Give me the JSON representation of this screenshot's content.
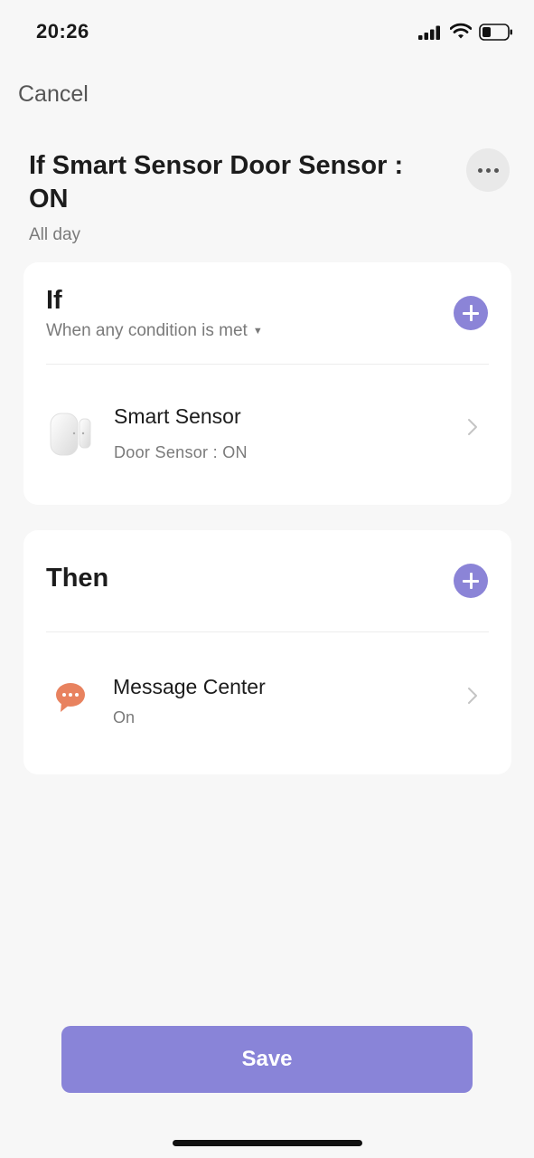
{
  "status_bar": {
    "time": "20:26"
  },
  "nav": {
    "cancel_label": "Cancel"
  },
  "header": {
    "title": "If Smart Sensor Door Sensor : ON",
    "subtitle": "All day"
  },
  "if_section": {
    "title": "If",
    "condition_mode": "When any condition is met",
    "items": [
      {
        "name": "Smart Sensor",
        "detail": "Door Sensor : ON",
        "icon": "door-sensor-icon"
      }
    ]
  },
  "then_section": {
    "title": "Then",
    "items": [
      {
        "name": "Message Center",
        "detail": "On",
        "icon": "message-bubble-icon"
      }
    ]
  },
  "footer": {
    "save_label": "Save"
  },
  "colors": {
    "accent": "#8b84d7",
    "message_icon": "#e8825f",
    "background": "#f7f7f7"
  }
}
